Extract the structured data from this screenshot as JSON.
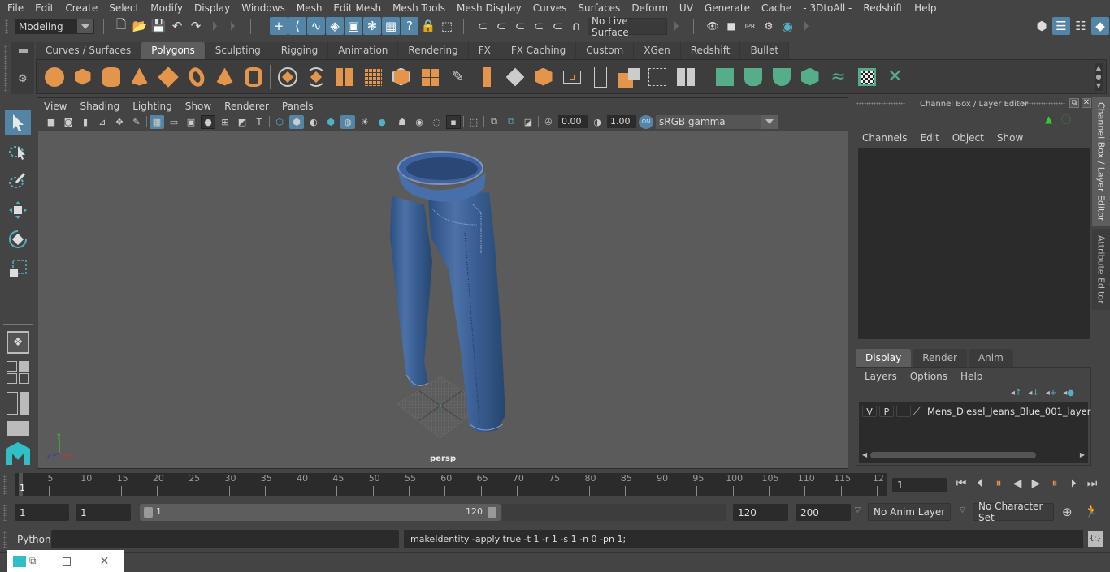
{
  "menubar": {
    "items": [
      "File",
      "Edit",
      "Create",
      "Select",
      "Modify",
      "Display",
      "Windows",
      "Mesh",
      "Edit Mesh",
      "Mesh Tools",
      "Mesh Display",
      "Curves",
      "Surfaces",
      "Deform",
      "UV",
      "Generate",
      "Cache",
      "- 3DtoAll -",
      "Redshift",
      "Help"
    ]
  },
  "statusline": {
    "mode": "Modeling",
    "live_surface": "No Live Surface",
    "icons": [
      "new-scene-icon",
      "open-scene-icon",
      "save-scene-icon",
      "undo-icon",
      "redo-icon",
      "select-hierarchy-icon",
      "select-object-icon",
      "select-component-icon",
      "snap-vertex-icon",
      "select-face-icon",
      "select-uv-icon",
      "select-multi-icon",
      "help-icon",
      "lock-icon",
      "select-highlight-icon",
      "snap-grid-icon",
      "snap-curve-icon",
      "snap-point-icon",
      "snap-view-icon",
      "snap-surface-icon",
      "magnet-icon"
    ],
    "render_icons": [
      "render-view-icon",
      "render-current-icon",
      "ipr-render-icon",
      "render-settings-icon",
      "hypershade-icon"
    ],
    "right_icons": [
      "modeling-toolkit-icon",
      "attribute-editor-toggle-icon",
      "tool-settings-icon",
      "channel-box-toggle-icon"
    ]
  },
  "shelf": {
    "tabs": [
      "Curves / Surfaces",
      "Polygons",
      "Sculpting",
      "Rigging",
      "Animation",
      "Rendering",
      "FX",
      "FX Caching",
      "Custom",
      "XGen",
      "Redshift",
      "Bullet"
    ],
    "active_tab": "Polygons",
    "tools": [
      "poly-sphere-icon",
      "poly-cube-icon",
      "poly-cylinder-icon",
      "poly-cone-icon",
      "poly-plane-icon",
      "poly-torus-icon",
      "poly-pyramid-icon",
      "poly-pipe-icon",
      "combine-icon",
      "separate-icon",
      "mirror-icon",
      "smooth-icon",
      "bevel-icon",
      "extract-icon",
      "bridge-icon",
      "multi-cut-icon",
      "extrude-icon",
      "edge-loop-icon",
      "append-icon",
      "center-pivot-icon",
      "freeze-transforms-icon",
      "triangulate-icon",
      "fill-hole-icon",
      "quadrangulate-icon",
      "planar-uv-icon",
      "cylindrical-uv-icon",
      "spherical-uv-icon",
      "automatic-uv-icon",
      "unfold-uv-icon",
      "uv-editor-icon",
      "uv-layout-icon"
    ]
  },
  "toolbox": {
    "tools": [
      "select-tool-icon",
      "lasso-tool-icon",
      "paint-select-tool-icon",
      "move-tool-icon",
      "rotate-tool-icon",
      "scale-tool-icon"
    ],
    "layouts": [
      "single-pane-layout-icon",
      "four-pane-layout-icon",
      "outliner-persp-layout-icon",
      "persp-graph-layout-icon"
    ]
  },
  "viewport": {
    "menus": [
      "View",
      "Shading",
      "Lighting",
      "Show",
      "Renderer",
      "Panels"
    ],
    "exposure": "0.00",
    "gamma": "1.00",
    "color_mgmt": "ON",
    "color_space": "sRGB gamma",
    "camera_label": "persp",
    "axes": {
      "x": "x",
      "y": "y",
      "z": "z"
    }
  },
  "channel_box": {
    "title": "Channel Box / Layer Editor",
    "menus": [
      "Channels",
      "Edit",
      "Object",
      "Show"
    ],
    "layer_tabs": [
      "Display",
      "Render",
      "Anim"
    ],
    "active_layer_tab": "Display",
    "layer_menus": [
      "Layers",
      "Options",
      "Help"
    ],
    "layers": [
      {
        "v": "V",
        "p": "P",
        "name": "Mens_Diesel_Jeans_Blue_001_layer"
      }
    ]
  },
  "side_tabs": [
    "Channel Box / Layer Editor",
    "Attribute Editor"
  ],
  "timeline": {
    "start_label": "1",
    "ticks": [
      "5",
      "10",
      "15",
      "20",
      "25",
      "30",
      "35",
      "40",
      "45",
      "50",
      "55",
      "60",
      "65",
      "70",
      "75",
      "80",
      "85",
      "90",
      "95",
      "100",
      "105",
      "110",
      "115",
      "12"
    ],
    "current_frame": "1"
  },
  "range": {
    "start": "1",
    "anim_start": "1",
    "slider_start": "1",
    "slider_end": "120",
    "anim_end": "120",
    "end": "200",
    "anim_layer": "No Anim Layer",
    "character_set": "No Character Set"
  },
  "command_line": {
    "language": "Python",
    "input": "",
    "result": "makeIdentity -apply true -t 1 -r 1 -s 1 -n 0 -pn 1;"
  }
}
